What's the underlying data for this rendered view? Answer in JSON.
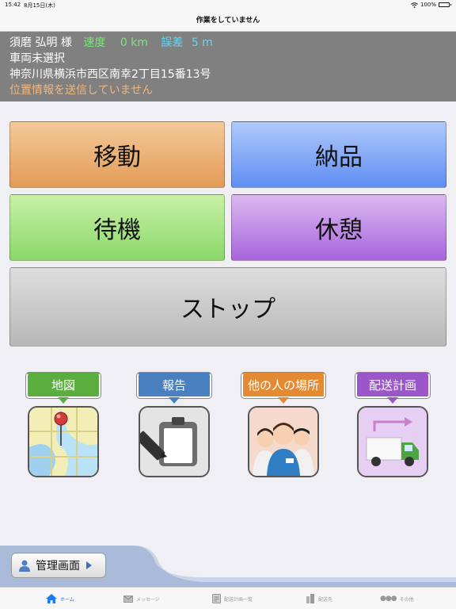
{
  "statusbar": {
    "time": "15:42",
    "date": "8月15日(木)",
    "battery": "100%"
  },
  "navbar": {
    "title": "作業をしていません"
  },
  "info": {
    "driver": "須磨 弘明 様",
    "speed_label": "速度",
    "speed_value": "0 km",
    "error_label": "誤差",
    "error_value": "5 m",
    "vehicle": "車両未選択",
    "address": "神奈川県横浜市西区南幸2丁目15番13号",
    "sending_status": "位置情報を送信していません"
  },
  "actions": {
    "move": "移動",
    "deliver": "納品",
    "wait": "待機",
    "rest": "休憩",
    "stop": "ストップ"
  },
  "apps": {
    "map": "地図",
    "report": "報告",
    "others_location": "他の人の場所",
    "delivery_plan": "配送計画"
  },
  "admin_button": "管理画面",
  "tabs": {
    "home": "ホーム",
    "message": "メッセージ",
    "plan_list": "配送計画一覧",
    "destination": "配送先",
    "other": "その他"
  },
  "colors": {
    "accent": "#1b7cf2",
    "speed": "#7fe27f",
    "error": "#6ed3f0",
    "sending": "#f3b67a"
  }
}
